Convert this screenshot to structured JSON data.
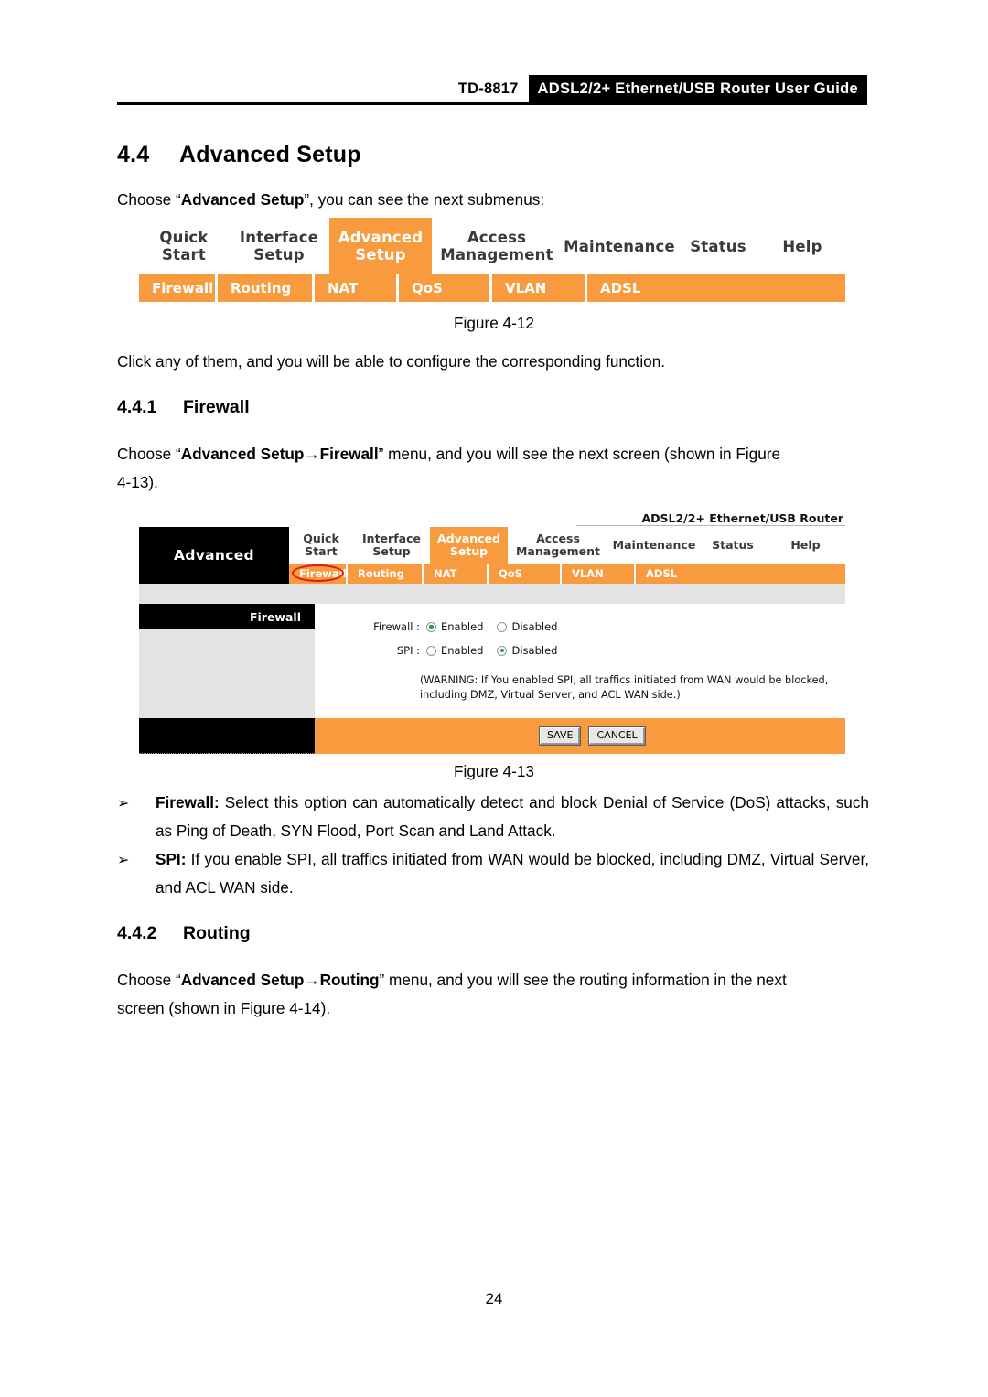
{
  "header": {
    "model": "TD-8817",
    "banner": "ADSL2/2+ Ethernet/USB Router User Guide"
  },
  "section": {
    "number": "4.4",
    "title": "Advanced Setup",
    "intro_before": "Choose “",
    "intro_bold": "Advanced Setup",
    "intro_after": "”, you can see the next submenus:"
  },
  "figure_412": {
    "caption": "Figure 4-12",
    "tabs": [
      {
        "label": "Quick\nStart",
        "line1": "Quick",
        "line2": "Start",
        "active": false
      },
      {
        "label": "Interface Setup",
        "line1": "Interface",
        "line2": "Setup",
        "active": false
      },
      {
        "label": "Advanced Setup",
        "line1": "Advanced",
        "line2": "Setup",
        "active": true
      },
      {
        "label": "Access Management",
        "line1": "Access",
        "line2": "Management",
        "active": false
      },
      {
        "label": "Maintenance",
        "line1": "Maintenance",
        "line2": "",
        "active": false
      },
      {
        "label": "Status",
        "line1": "Status",
        "line2": "",
        "active": false
      },
      {
        "label": "Help",
        "line1": "Help",
        "line2": "",
        "active": false
      }
    ],
    "subtabs": [
      "Firewall",
      "Routing",
      "NAT",
      "QoS",
      "VLAN",
      "ADSL"
    ]
  },
  "after_fig12": "Click any of them, and you will be able to configure the corresponding function.",
  "subsection_441": {
    "number": "4.4.1",
    "title": "Firewall",
    "para_a": "Choose “",
    "para_bold": "Advanced Setup→Firewall",
    "para_b": "” menu, and you will see the next screen (shown in Figure",
    "para_c": "4-13)."
  },
  "figure_413": {
    "caption": "Figure 4-13",
    "model_text": "ADSL2/2+ Ethernet/USB Router",
    "brand": "Advanced",
    "tabs": [
      {
        "line1": "Quick",
        "line2": "Start",
        "active": false
      },
      {
        "line1": "Interface",
        "line2": "Setup",
        "active": false
      },
      {
        "line1": "Advanced",
        "line2": "Setup",
        "active": true
      },
      {
        "line1": "Access",
        "line2": "Management",
        "active": false
      },
      {
        "line1": "Maintenance",
        "line2": "",
        "active": false
      },
      {
        "line1": "Status",
        "line2": "",
        "active": false
      },
      {
        "line1": "Help",
        "line2": "",
        "active": false
      }
    ],
    "subtabs": [
      "Firewall",
      "Routing",
      "NAT",
      "QoS",
      "VLAN",
      "ADSL"
    ],
    "annotated_subtab": "Firewall",
    "side_title": "Firewall",
    "form": {
      "firewall_label": "Firewall :",
      "firewall_enabled_label": "Enabled",
      "firewall_disabled_label": "Disabled",
      "firewall_value": "Enabled",
      "spi_label": "SPI :",
      "spi_enabled_label": "Enabled",
      "spi_disabled_label": "Disabled",
      "spi_value": "Disabled",
      "warning": "(WARNING: If You enabled SPI, all traffics initiated from WAN would be blocked, including DMZ, Virtual Server, and ACL WAN side.)",
      "save_label": "SAVE",
      "cancel_label": "CANCEL"
    }
  },
  "bullets": [
    {
      "marker": "➢",
      "bold": "Firewall:",
      "text": " Select this option can automatically detect and block Denial of Service (DoS) attacks, such as Ping of Death, SYN Flood, Port Scan and Land Attack."
    },
    {
      "marker": "➢",
      "bold": "SPI:",
      "text": " If you enable SPI, all traffics initiated from WAN would be blocked, including DMZ, Virtual Server, and ACL WAN side."
    }
  ],
  "subsection_442": {
    "number": "4.4.2",
    "title": "Routing",
    "para_a": "Choose “",
    "para_bold": "Advanced Setup→Routing",
    "para_b": "” menu, and you will see the routing information in the next",
    "para_c": "screen (shown in Figure 4-14)."
  },
  "page_number": "24",
  "colors": {
    "accent_orange": "#F79B3E",
    "annotation_red": "#E01B13",
    "panel_grey": "#e3e3e3",
    "black": "#000000"
  }
}
